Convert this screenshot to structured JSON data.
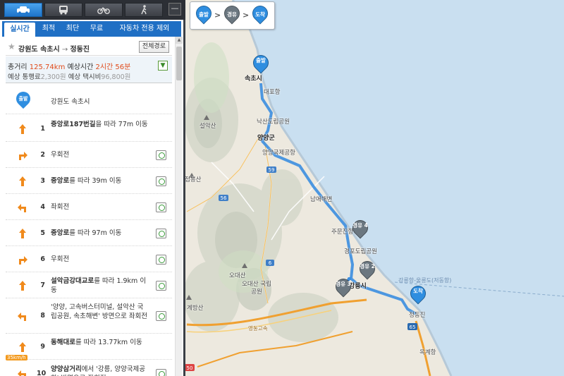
{
  "panel": {
    "transport_modes": [
      {
        "name": "car",
        "icon": "car-icon",
        "active": true
      },
      {
        "name": "bus",
        "icon": "bus-icon",
        "active": false
      },
      {
        "name": "bike",
        "icon": "bike-icon",
        "active": false
      },
      {
        "name": "walk",
        "icon": "walk-icon",
        "active": false
      }
    ],
    "minimize_label": "—",
    "tabs": [
      "실시간",
      "최적",
      "최단",
      "무료",
      "자동차 전용 제외"
    ],
    "active_tab": "실시간",
    "route_title": "강원도 속초시",
    "route_arrow": " → ",
    "route_dest": "정동진",
    "full_route_button": "전체경로",
    "summary": {
      "distance_label": "총거리 ",
      "distance_value": "125.74km",
      "time_label": "  예상시간 ",
      "time_value": "2시간 56분",
      "toll_label": "예상 통행료",
      "toll_value": "2,300원",
      "taxi_label": "  예상 택시비",
      "taxi_value": "96,800원"
    },
    "start_pin_label": "출발",
    "start_name": "강원도 속초시",
    "steps": [
      {
        "num": "1",
        "bold": "중앙로187번길",
        "rest": "을 따라 77m 이동",
        "icon": "straight-arrow-icon",
        "cam": false
      },
      {
        "num": "2",
        "bold": "",
        "rest": "우회전",
        "icon": "turn-right-icon",
        "cam": true
      },
      {
        "num": "3",
        "bold": "중앙로",
        "rest": "를 따라 39m 이동",
        "icon": "straight-arrow-icon",
        "cam": true
      },
      {
        "num": "4",
        "bold": "",
        "rest": "좌회전",
        "icon": "turn-left-icon",
        "cam": true
      },
      {
        "num": "5",
        "bold": "중앙로",
        "rest": "를 따라 97m 이동",
        "icon": "straight-arrow-icon",
        "cam": true
      },
      {
        "num": "6",
        "bold": "",
        "rest": "우회전",
        "icon": "turn-right-icon",
        "cam": true
      },
      {
        "num": "7",
        "bold": "설악금강대교로",
        "rest": "를 따라 1.9km 이동",
        "icon": "straight-arrow-icon",
        "cam": true
      },
      {
        "num": "8",
        "bold": "",
        "rest": "'양양, 고속버스터미널, 설악산 국립공원, 속초해변' 방면으로 좌회전",
        "icon": "turn-left-icon",
        "cam": true
      },
      {
        "num": "9",
        "bold": "동해대로",
        "rest": "를 따라 13.77km 이동",
        "icon": "straight-arrow-icon",
        "cam": false,
        "badge": "35km/h"
      },
      {
        "num": "10",
        "bold": "양양삼거리",
        "rest": "에서 '강릉, 양양국제공항' 방면으로 좌회전",
        "icon": "turn-left-icon",
        "cam": true
      }
    ]
  },
  "waypoints_box": {
    "items": [
      "출발",
      "경유",
      "도착"
    ],
    "separator": ">"
  },
  "map": {
    "labels": [
      {
        "text": "속초시",
        "bold": true
      },
      {
        "text": "대포항"
      },
      {
        "text": "설악산"
      },
      {
        "text": "낙산도립공원"
      },
      {
        "text": "양양군",
        "bold": true
      },
      {
        "text": "양양국제공항"
      },
      {
        "text": "점봉산"
      },
      {
        "text": "남애해변"
      },
      {
        "text": "주문진항"
      },
      {
        "text": "경포도립공원"
      },
      {
        "text": "오대산"
      },
      {
        "text": "오대산 국립공원"
      },
      {
        "text": "강릉시",
        "bold": true
      },
      {
        "text": "계방산"
      },
      {
        "text": "영동고속"
      },
      {
        "text": "정동진"
      },
      {
        "text": "옥계항"
      },
      {
        "text": "강릉항-울릉도(저동항)",
        "sea": true
      }
    ],
    "road_numbers": [
      "59",
      "56",
      "6",
      "65",
      "50"
    ],
    "markers": [
      {
        "label": "출발",
        "type": "start"
      },
      {
        "label": "도착",
        "type": "end"
      },
      {
        "label": "경유 4",
        "type": "via"
      },
      {
        "label": "경유 2",
        "type": "via"
      },
      {
        "label": "경유 3",
        "type": "via"
      }
    ],
    "colors": {
      "route": "#3b8ee0",
      "sea": "#c9dff0",
      "land": "#efece3",
      "highway": "#f0a030"
    }
  }
}
